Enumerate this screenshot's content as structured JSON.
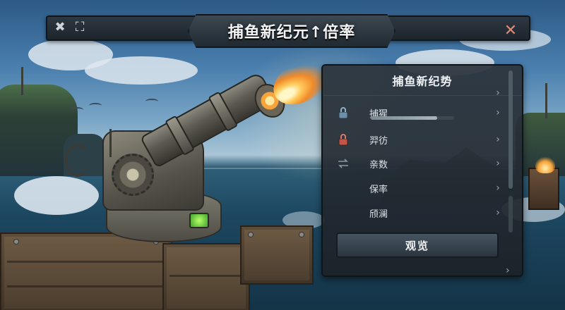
{
  "header": {
    "title": "捕鱼新纪元↑倍率",
    "close_glyph": "✕",
    "left_icons": [
      {
        "name": "tools-icon",
        "glyph": "✖"
      },
      {
        "name": "fullscreen-icon",
        "glyph": "⛶"
      }
    ]
  },
  "panel": {
    "title": "捕鱼新纪势",
    "rows": [
      {
        "label": "",
        "icon": "",
        "chevron": "›"
      },
      {
        "label": "捕猩",
        "icon": "lock-icon",
        "chevron": "›",
        "has_slider": true,
        "slider_value": 0.8
      },
      {
        "label": "羿彷",
        "icon": "lock-red-icon",
        "chevron": "›"
      },
      {
        "label": "亲数",
        "icon": "swap-icon",
        "chevron": "›"
      },
      {
        "label": "保率",
        "icon": "",
        "chevron": "›"
      },
      {
        "label": "颀澜",
        "icon": "",
        "chevron": "›"
      }
    ],
    "action_label": "观览",
    "bottom_chevron": "›"
  },
  "colors": {
    "panel_bg": "#2c343c",
    "accent_close": "#e08a76",
    "lock_blue": "#6f8fa8",
    "lock_red": "#c0554a"
  }
}
